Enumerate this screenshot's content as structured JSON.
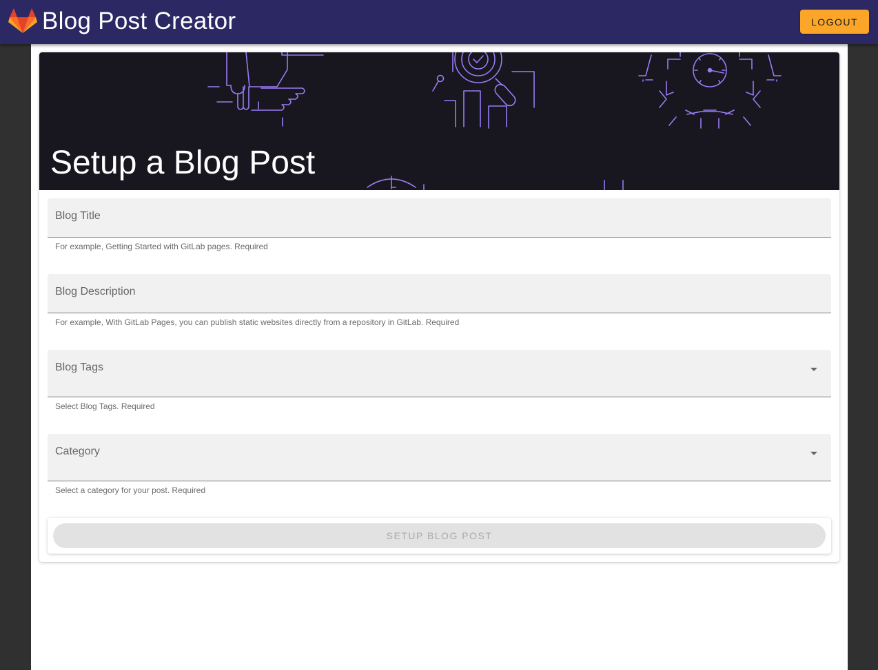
{
  "appbar": {
    "title": "Blog Post Creator",
    "logout_label": "LOGOUT",
    "logo_icon": "gitlab-fox-icon",
    "background_color": "#2c2864",
    "button_color": "#fba629"
  },
  "hero": {
    "title": "Setup a Blog Post",
    "background_color": "#18161f",
    "line_art_color": "#9b7bf5"
  },
  "form": {
    "fields": [
      {
        "label": "Blog Title",
        "value": "",
        "hint": "For example, Getting Started with GitLab pages. Required",
        "type": "text"
      },
      {
        "label": "Blog Description",
        "value": "",
        "hint": "For example, With GitLab Pages, you can publish static websites directly from a repository in GitLab. Required",
        "type": "text"
      },
      {
        "label": "Blog Tags",
        "value": "",
        "hint": "Select Blog Tags. Required",
        "type": "select",
        "icon": "chevron-down-icon"
      },
      {
        "label": "Category",
        "value": "",
        "hint": "Select a category for your post. Required",
        "type": "select",
        "icon": "chevron-down-icon"
      }
    ],
    "submit_label": "SETUP BLOG POST",
    "submit_disabled": true
  }
}
